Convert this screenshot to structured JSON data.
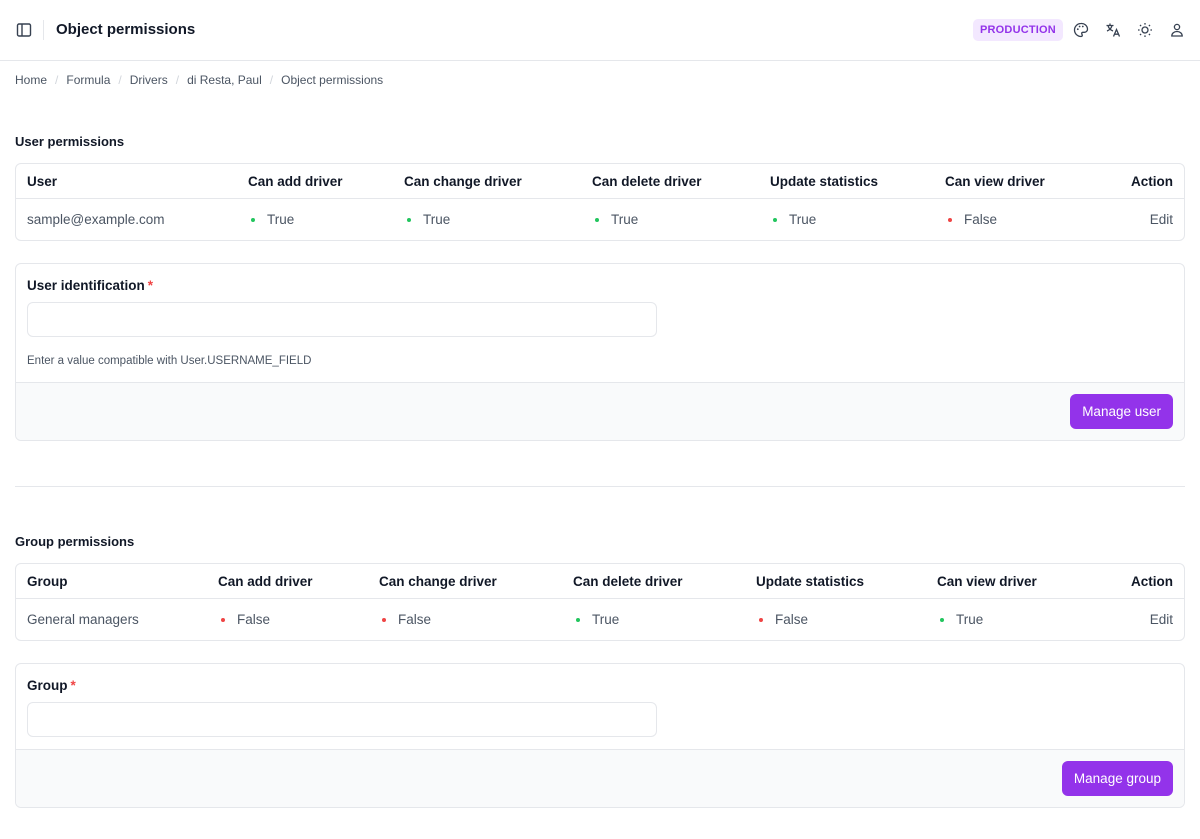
{
  "header": {
    "title": "Object permissions",
    "environment_badge": "PRODUCTION",
    "icons": [
      "sidebar-toggle-icon",
      "palette-icon",
      "translate-icon",
      "sun-icon",
      "user-icon"
    ]
  },
  "breadcrumb": [
    "Home",
    "Formula",
    "Drivers",
    "di Resta, Paul",
    "Object permissions"
  ],
  "colors": {
    "accent": "#9333ea",
    "badge_bg": "#f3e8ff",
    "true_dot": "#22c55e",
    "false_dot": "#ef4444"
  },
  "user_permissions": {
    "title": "User permissions",
    "columns": [
      "User",
      "Can add driver",
      "Can change driver",
      "Can delete driver",
      "Update statistics",
      "Can view driver",
      "Action"
    ],
    "rows": [
      {
        "name": "sample@example.com",
        "values": [
          "True",
          "True",
          "True",
          "True",
          "False"
        ],
        "action": "Edit"
      }
    ],
    "form": {
      "label": "User identification",
      "required_mark": "*",
      "value": "",
      "help_text": "Enter a value compatible with User.USERNAME_FIELD",
      "button": "Manage user"
    }
  },
  "group_permissions": {
    "title": "Group permissions",
    "columns": [
      "Group",
      "Can add driver",
      "Can change driver",
      "Can delete driver",
      "Update statistics",
      "Can view driver",
      "Action"
    ],
    "rows": [
      {
        "name": "General managers",
        "values": [
          "False",
          "False",
          "True",
          "False",
          "True"
        ],
        "action": "Edit"
      }
    ],
    "form": {
      "label": "Group",
      "required_mark": "*",
      "value": "",
      "button": "Manage group"
    }
  }
}
